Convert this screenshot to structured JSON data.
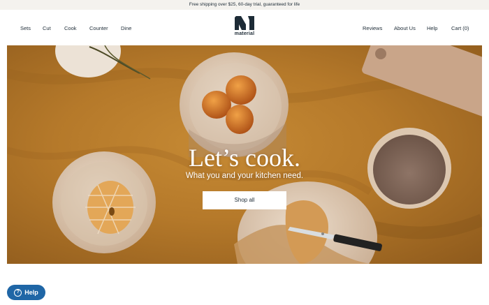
{
  "announcement": "Free shipping over $25, 60-day trial, guaranteed for life",
  "nav": {
    "left": [
      "Sets",
      "Cut",
      "Cook",
      "Counter",
      "Dine"
    ],
    "right": [
      "Reviews",
      "About Us",
      "Help",
      "Cart (0)"
    ],
    "logo_text": "material"
  },
  "hero": {
    "title": "Let’s cook.",
    "subtitle": "What you and your kitchen need.",
    "cta": "Shop all"
  },
  "help_widget": {
    "label": "Help",
    "icon": "question-circle-icon"
  },
  "colors": {
    "text": "#1d2b36",
    "tablecloth": "#b5792a",
    "help_widget_bg": "#1f66a6"
  }
}
